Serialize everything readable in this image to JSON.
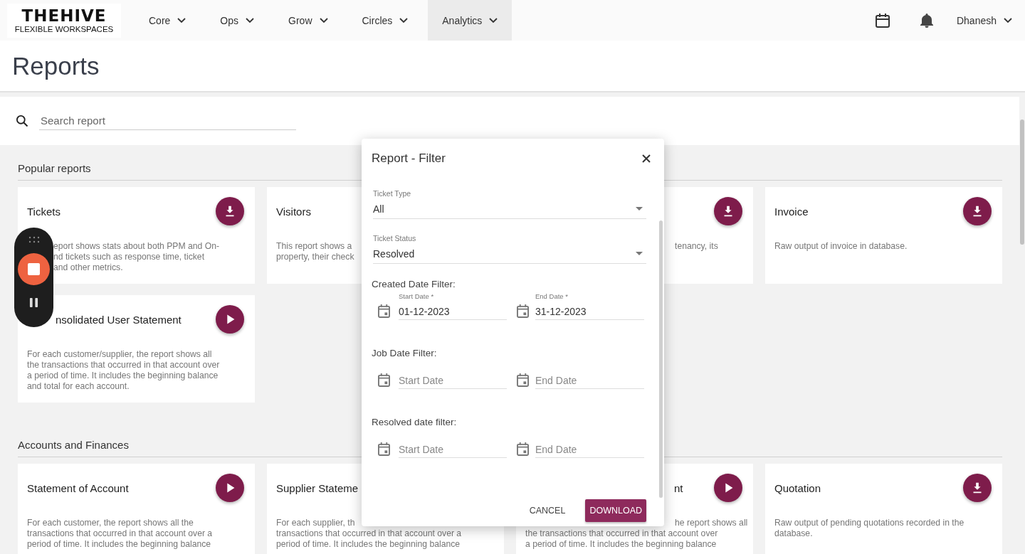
{
  "header": {
    "logo": {
      "name": "THEHIVE",
      "tagline": "FLEXIBLE WORKSPACES"
    },
    "nav": [
      {
        "label": "Core",
        "selected": false
      },
      {
        "label": "Ops",
        "selected": false
      },
      {
        "label": "Grow",
        "selected": false
      },
      {
        "label": "Circles",
        "selected": false
      },
      {
        "label": "Analytics",
        "selected": true
      }
    ],
    "user": "Dhanesh"
  },
  "page_title": "Reports",
  "search": {
    "placeholder": "Search report"
  },
  "sections": [
    {
      "title": "Popular reports",
      "cards": [
        {
          "kind": "recorder",
          "title": {
            "text": "Tickets",
            "kind": "whole"
          },
          "button": {
            "kind": "download"
          },
          "lines": [
            {
              "text": "eport shows stats about both PPM and On-",
              "kind": "partial"
            },
            {
              "text": "nd tickets such as response time, ticket",
              "kind": "partial"
            },
            {
              "text": "and other metrics.",
              "kind": "partial"
            }
          ]
        },
        {
          "kind": "dialog_left",
          "title": {
            "text": "Visitors",
            "kind": "whole"
          },
          "lines": [
            {
              "text": "This report shows a",
              "kind": "partial"
            },
            {
              "text": "property, their check",
              "kind": "partial"
            }
          ]
        },
        {
          "kind": "dialog_right",
          "button": {
            "kind": "download"
          },
          "lines": [
            {
              "text": "tenancy, its",
              "kind": "partial"
            }
          ]
        },
        {
          "kind": "plain",
          "title": {
            "text": "Invoice",
            "kind": "whole"
          },
          "button": {
            "kind": "download"
          },
          "lines": [
            {
              "text": "Raw output of invoice in database.",
              "kind": "whole"
            }
          ]
        },
        {
          "kind": "recorder",
          "title": {
            "text": "nsolidated User Statement",
            "kind": "partial"
          },
          "button": {
            "kind": "run"
          },
          "lines": [
            {
              "text": "For each customer/supplier, the report shows all",
              "kind": "whole"
            },
            {
              "text": "the transactions that occurred in that account over",
              "kind": "whole"
            },
            {
              "text": "a period of time. It includes the beginning balance",
              "kind": "whole"
            },
            {
              "text": "and total for each account.",
              "kind": "whole"
            }
          ]
        }
      ]
    },
    {
      "title": "Accounts and Finances",
      "cards": [
        {
          "kind": "plain",
          "title": {
            "text": "Statement of Account",
            "kind": "whole"
          },
          "button": {
            "kind": "run"
          },
          "lines": [
            {
              "text": "For each customer, the report shows all the",
              "kind": "whole"
            },
            {
              "text": "transactions that occurred in that account over a",
              "kind": "whole"
            },
            {
              "text": "period of time. It includes the beginning balance",
              "kind": "whole"
            }
          ]
        },
        {
          "kind": "dialog_left",
          "title": {
            "text": "Supplier Stateme",
            "kind": "partial"
          },
          "lines": [
            {
              "text": "For each supplier, th",
              "kind": "partial"
            },
            {
              "text": "transactions that occurred in that account over a",
              "kind": "whole"
            },
            {
              "text": "period of time. It includes the beginning balance",
              "kind": "whole"
            }
          ]
        },
        {
          "kind": "dialog_right",
          "title": {
            "text": "nt",
            "kind": "partial"
          },
          "button": {
            "kind": "run"
          },
          "lines": [
            {
              "text": "he report shows all",
              "kind": "partial"
            },
            {
              "text": "the transactions that occurred in that account over",
              "kind": "whole"
            },
            {
              "text": "a period of time. It includes the beginning balance",
              "kind": "whole"
            }
          ]
        },
        {
          "kind": "plain",
          "title": {
            "text": "Quotation",
            "kind": "whole"
          },
          "button": {
            "kind": "download"
          },
          "lines": [
            {
              "text": "Raw output of pending quotations recorded in the",
              "kind": "whole"
            },
            {
              "text": "database.",
              "kind": "whole"
            }
          ]
        }
      ]
    }
  ],
  "dialog": {
    "title": "Report - Filter",
    "selects": [
      {
        "label": "Ticket Type",
        "value": "All"
      },
      {
        "label": "Ticket Status",
        "value": "Resolved"
      }
    ],
    "groups": [
      {
        "heading": "Created Date Filter:",
        "fields": [
          {
            "label": "Start Date *",
            "value": "01-12-2023"
          },
          {
            "label": "End Date *",
            "value": "31-12-2023"
          }
        ]
      },
      {
        "heading": "Job Date Filter:",
        "fields": [
          {
            "placeholder": "Start Date"
          },
          {
            "placeholder": "End Date"
          }
        ]
      },
      {
        "heading": "Resolved date filter:",
        "fields": [
          {
            "placeholder": "Start Date"
          },
          {
            "placeholder": "End Date"
          }
        ]
      }
    ],
    "buttons": [
      {
        "label": "CANCEL",
        "kind": "text"
      },
      {
        "label": "DOWNLOAD",
        "kind": "primary"
      }
    ]
  }
}
